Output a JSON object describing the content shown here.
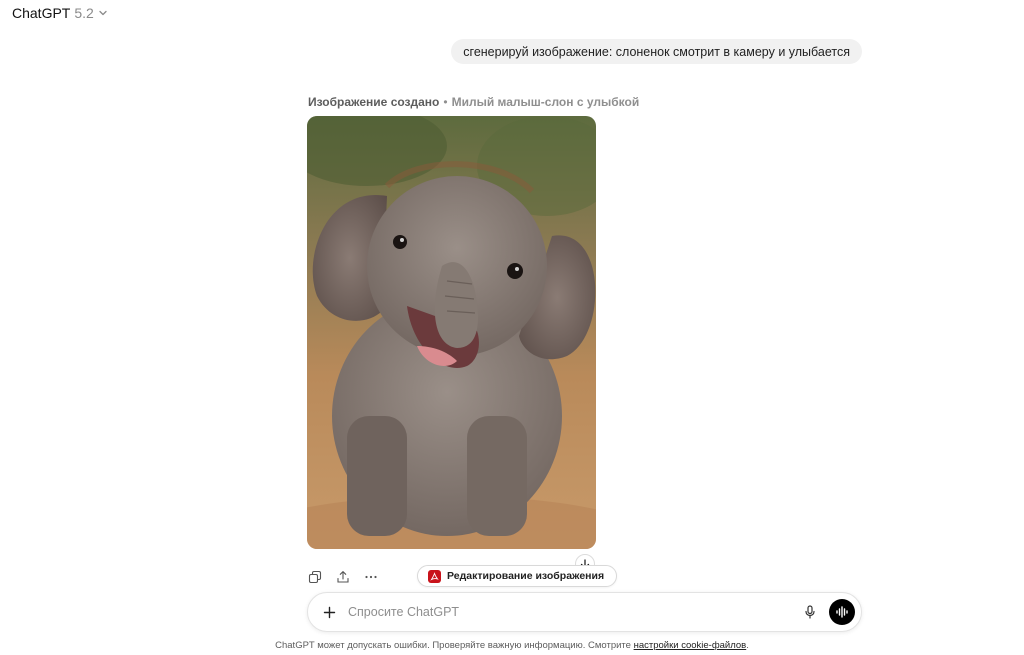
{
  "header": {
    "model_name": "ChatGPT",
    "model_version": "5.2",
    "dropdown_icon": "chevron-down-icon"
  },
  "conversation": {
    "user_message": "сгенерируй изображение: слоненок смотрит в камеру и улыбается",
    "assistant": {
      "status": "Изображение создано",
      "separator": "•",
      "image_title": "Милый малыш-слон с улыбкой"
    }
  },
  "actions": {
    "copy_icon": "copy-icon",
    "share_icon": "share-icon",
    "more_icon": "more-icon",
    "edit_label": "Редактирование изображения",
    "scroll_icon": "arrow-down-icon"
  },
  "composer": {
    "placeholder": "Спросите ChatGPT",
    "plus_icon": "plus-icon",
    "mic_icon": "mic-icon",
    "voice_icon": "voice-mode-icon"
  },
  "footer": {
    "text": "ChatGPT может допускать ошибки. Проверяйте важную информацию. Смотрите ",
    "link": "настройки cookie-файлов",
    "suffix": "."
  },
  "colors": {
    "bubble_bg": "#f1f1f1",
    "voice_bg": "#000000",
    "pdf_red": "#c9131b"
  }
}
